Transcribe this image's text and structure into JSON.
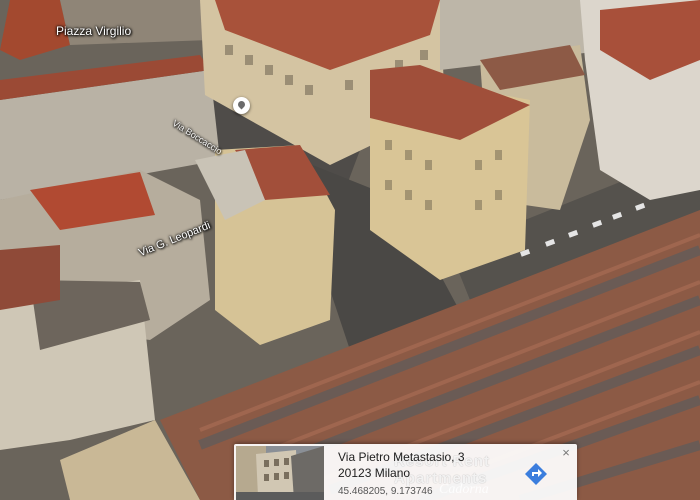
{
  "map": {
    "labels": {
      "piazza": "Piazza Virgilio",
      "leopardi": "Via G. Leopardi",
      "street2": "Via Boccaccio"
    }
  },
  "info_card": {
    "title": "Via Pietro Metastasio, 3",
    "city": "20123 Milano",
    "coordinates": "45.468205, 9.173746",
    "overlay_text": "Resort Rent Apartments",
    "overlay_text2": "Cadorna",
    "close_glyph": "×",
    "direction_icon_color": "#3b7ddd"
  },
  "colors": {
    "roof_terracotta": "#a4533c",
    "facade_cream": "#d8c7a0",
    "street": "#4c4a47"
  }
}
